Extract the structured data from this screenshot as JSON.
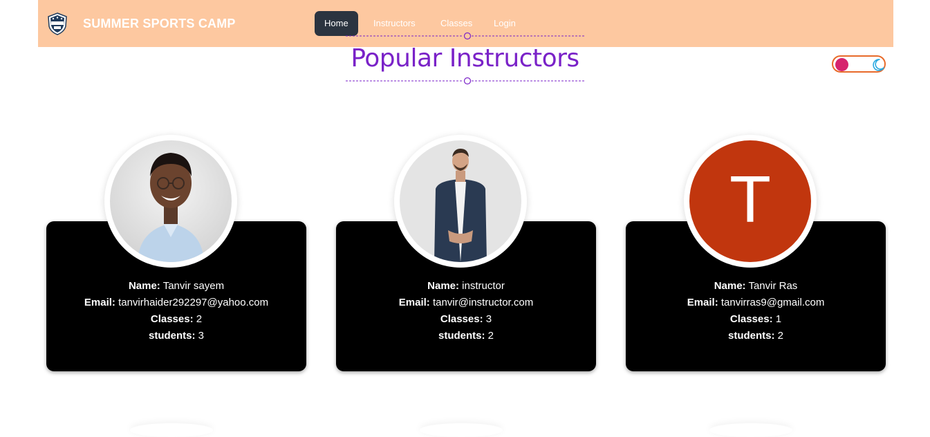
{
  "navbar": {
    "brand": "SUMMER SPORTS CAMP",
    "logo_icon": "shield-logo-icon",
    "items": [
      {
        "label": "Home",
        "active": true
      },
      {
        "label": "Instructors",
        "active": false
      },
      {
        "label": "Classes",
        "active": false
      },
      {
        "label": "Login",
        "active": false
      }
    ]
  },
  "section": {
    "title": "Popular Instructors"
  },
  "theme_toggle": {
    "icon": "moon-icon",
    "knob_color": "#d6246e",
    "border_color": "#e86a2a"
  },
  "colors": {
    "navbar_bg": "#fdc8a0",
    "title": "#7a22c8",
    "card_bg": "#000000",
    "avatar_letter_bg": "#c1360e"
  },
  "field_labels": {
    "name": "Name:",
    "email": "Email:",
    "classes": "Classes:",
    "students": "students:"
  },
  "instructors": [
    {
      "name": "Tanvir sayem",
      "email": "tanvirhaider292297@yahoo.com",
      "classes": "2",
      "students": "3",
      "avatar": "photo"
    },
    {
      "name": "instructor",
      "email": "tanvir@instructor.com",
      "classes": "3",
      "students": "2",
      "avatar": "photo"
    },
    {
      "name": "Tanvir Ras",
      "email": "tanvirras9@gmail.com",
      "classes": "1",
      "students": "2",
      "avatar": "letter",
      "avatar_letter": "T"
    }
  ]
}
